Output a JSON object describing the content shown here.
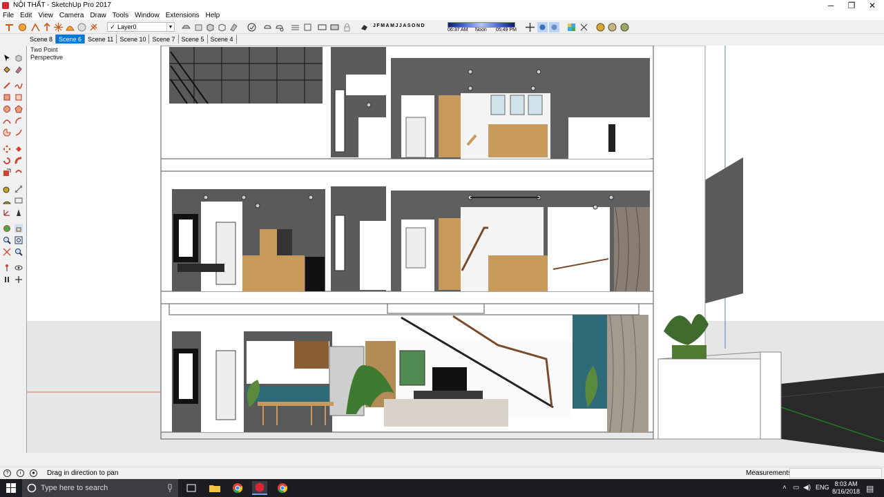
{
  "window": {
    "title": "NỘI THẤT - SketchUp Pro 2017",
    "minimize": "─",
    "restore": "❐",
    "close": "✕"
  },
  "menu": [
    "File",
    "Edit",
    "View",
    "Camera",
    "Draw",
    "Tools",
    "Window",
    "Extensions",
    "Help"
  ],
  "toolbar": {
    "layer_check": "✓",
    "layer": "Layer0",
    "months": [
      "J",
      "F",
      "M",
      "A",
      "M",
      "J",
      "J",
      "A",
      "S",
      "O",
      "N",
      "D"
    ],
    "time_start": "06:37 AM",
    "time_noon": "Noon",
    "time_end": "05:49 PM"
  },
  "scenes": {
    "tabs": [
      "Scene 8",
      "Scene 6",
      "Scene 11",
      "Scene 10",
      "Scene 7",
      "Scene 5",
      "Scene 4"
    ],
    "active": "Scene 6"
  },
  "viewport": {
    "camera_line1": "Two Point",
    "camera_line2": "Perspective"
  },
  "status": {
    "hint": "Drag in direction to pan",
    "measurements_label": "Measurements",
    "measurements_value": ""
  },
  "taskbar": {
    "search_placeholder": "Type here to search",
    "language": "ENG",
    "time": "8:03 AM",
    "date": "8/16/2018"
  },
  "colors": {
    "accent": "#0078d7",
    "wall_dark": "#4b4b4b",
    "wood": "#c7995a",
    "teal": "#2f6a78"
  }
}
